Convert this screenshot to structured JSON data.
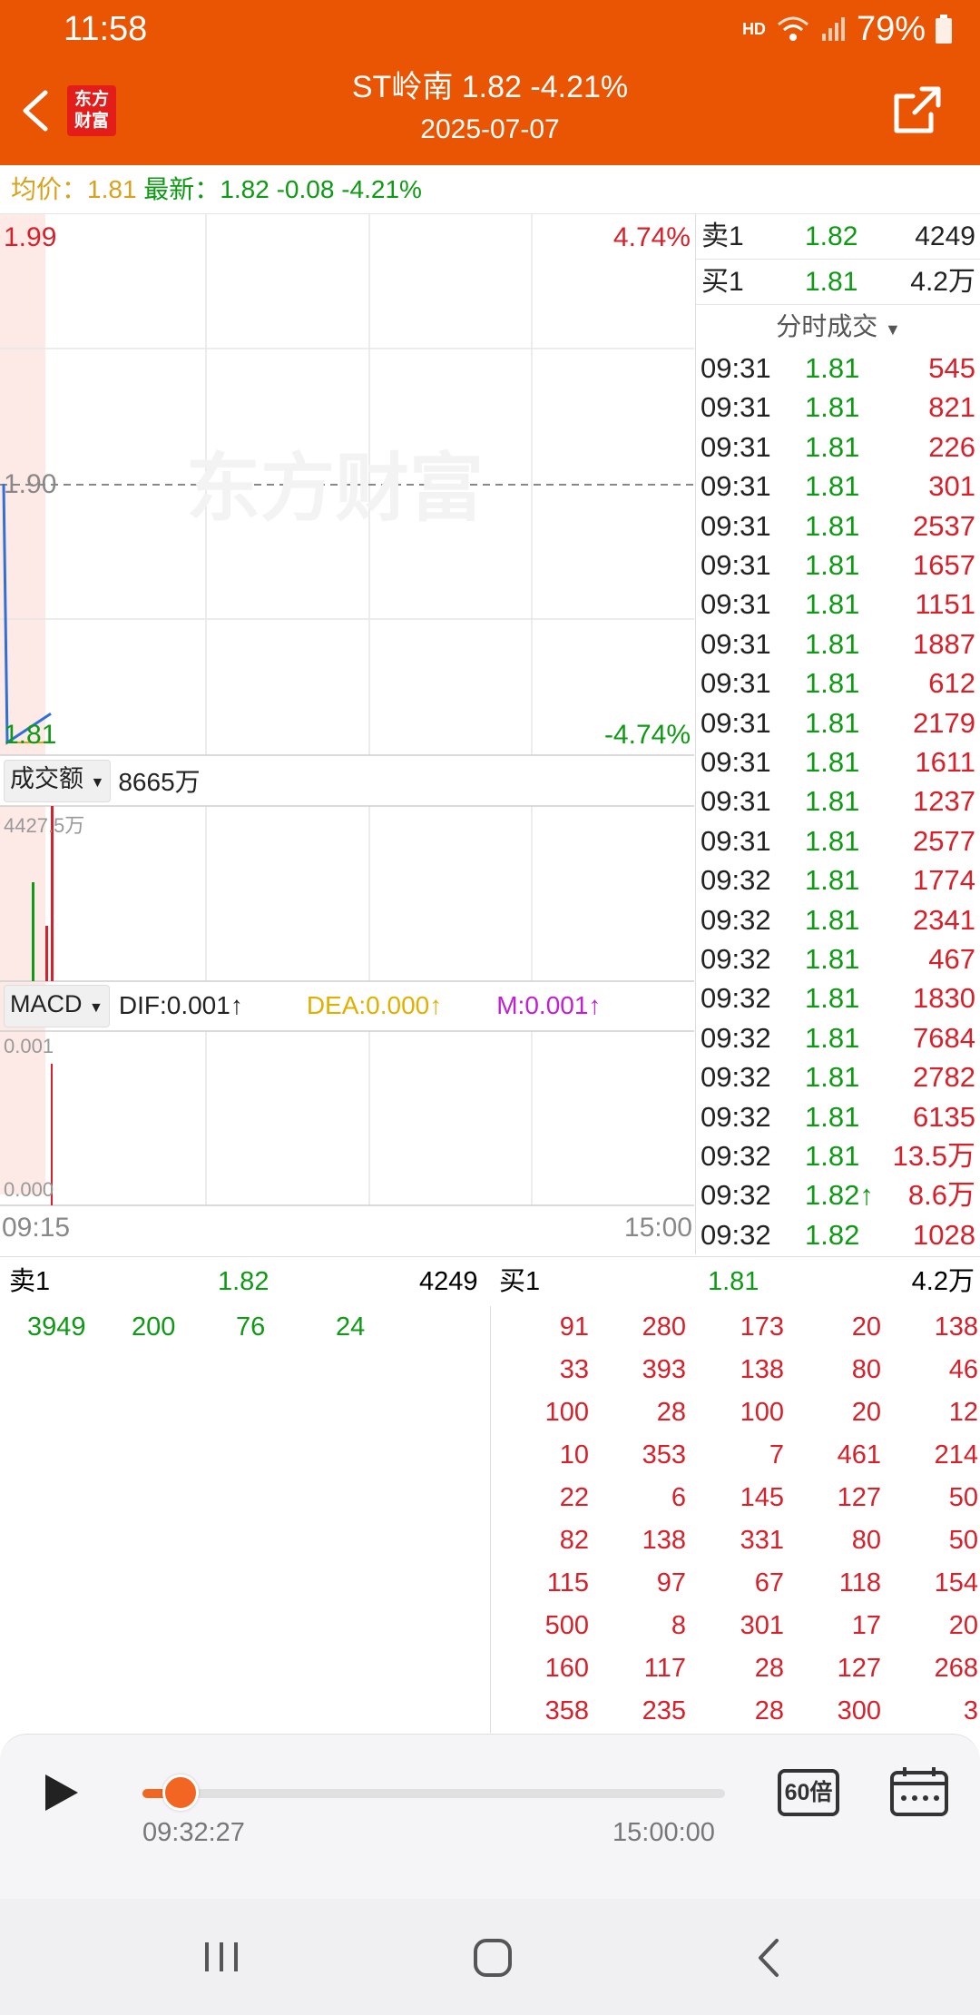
{
  "status_bar": {
    "time": "11:58",
    "network": "HD",
    "battery": "79%"
  },
  "header": {
    "title": "ST岭南  1.82  -4.21%",
    "date": "2025-07-07",
    "logo_text": "东方财富"
  },
  "summary": {
    "avg_label": "均价：",
    "avg_value": "1.81",
    "latest_label": "最新：",
    "latest_value": "1.82",
    "change": "-0.08",
    "change_pct": "-4.21%"
  },
  "chart": {
    "price_high": "1.99",
    "price_mid": "1.90",
    "price_low": "1.81",
    "pct_high": "4.74%",
    "pct_low": "-4.74%",
    "watermark": "东方财富",
    "volume_selector": "成交额",
    "volume_total": "8665万",
    "volume_max": "4427.5万",
    "macd_selector": "MACD",
    "dif": "DIF:0.001",
    "dea": "DEA:0.000",
    "m": "M:0.001",
    "macd_top": "0.001",
    "macd_bottom": "0.000",
    "time_start": "09:15",
    "time_end": "15:00"
  },
  "chart_data": {
    "type": "line",
    "series": [
      {
        "name": "price",
        "x": [
          "09:30",
          "09:31",
          "09:32"
        ],
        "values": [
          1.9,
          1.81,
          1.82
        ]
      }
    ],
    "ylim": [
      1.81,
      1.99
    ],
    "xlabel": "",
    "ylabel": ""
  },
  "quotes": {
    "sell1_label": "卖1",
    "sell1_price": "1.82",
    "sell1_vol": "4249",
    "buy1_label": "买1",
    "buy1_price": "1.81",
    "buy1_vol": "4.2万",
    "trades_title": "分时成交"
  },
  "trades": [
    {
      "time": "09:31",
      "price": "1.81",
      "vol": "545"
    },
    {
      "time": "09:31",
      "price": "1.81",
      "vol": "821"
    },
    {
      "time": "09:31",
      "price": "1.81",
      "vol": "226"
    },
    {
      "time": "09:31",
      "price": "1.81",
      "vol": "301"
    },
    {
      "time": "09:31",
      "price": "1.81",
      "vol": "2537"
    },
    {
      "time": "09:31",
      "price": "1.81",
      "vol": "1657"
    },
    {
      "time": "09:31",
      "price": "1.81",
      "vol": "1151"
    },
    {
      "time": "09:31",
      "price": "1.81",
      "vol": "1887"
    },
    {
      "time": "09:31",
      "price": "1.81",
      "vol": "612"
    },
    {
      "time": "09:31",
      "price": "1.81",
      "vol": "2179"
    },
    {
      "time": "09:31",
      "price": "1.81",
      "vol": "1611"
    },
    {
      "time": "09:31",
      "price": "1.81",
      "vol": "1237"
    },
    {
      "time": "09:31",
      "price": "1.81",
      "vol": "2577"
    },
    {
      "time": "09:32",
      "price": "1.81",
      "vol": "1774"
    },
    {
      "time": "09:32",
      "price": "1.81",
      "vol": "2341"
    },
    {
      "time": "09:32",
      "price": "1.81",
      "vol": "467"
    },
    {
      "time": "09:32",
      "price": "1.81",
      "vol": "1830"
    },
    {
      "time": "09:32",
      "price": "1.81",
      "vol": "7684"
    },
    {
      "time": "09:32",
      "price": "1.81",
      "vol": "2782"
    },
    {
      "time": "09:32",
      "price": "1.81",
      "vol": "6135"
    },
    {
      "time": "09:32",
      "price": "1.81",
      "vol": "13.5万"
    },
    {
      "time": "09:32",
      "price": "1.82↑",
      "vol": "8.6万"
    },
    {
      "time": "09:32",
      "price": "1.82",
      "vol": "1028"
    }
  ],
  "orderbook": {
    "sell_label": "卖1",
    "sell_price": "1.82",
    "sell_vol": "4249",
    "buy_label": "买1",
    "buy_price": "1.81",
    "buy_vol": "4.2万",
    "sell_queue": [
      "3949",
      "200",
      "76",
      "24"
    ],
    "buy_queue": [
      [
        "91",
        "280",
        "173",
        "20",
        "138"
      ],
      [
        "33",
        "393",
        "138",
        "80",
        "46"
      ],
      [
        "100",
        "28",
        "100",
        "20",
        "12"
      ],
      [
        "10",
        "353",
        "7",
        "461",
        "214"
      ],
      [
        "22",
        "6",
        "145",
        "127",
        "50"
      ],
      [
        "82",
        "138",
        "331",
        "80",
        "50"
      ],
      [
        "115",
        "97",
        "67",
        "118",
        "154"
      ],
      [
        "500",
        "8",
        "301",
        "17",
        "20"
      ],
      [
        "160",
        "117",
        "28",
        "127",
        "268"
      ],
      [
        "358",
        "235",
        "28",
        "300",
        "3"
      ]
    ]
  },
  "player": {
    "current_time": "09:32:27",
    "end_time": "15:00:00",
    "speed": "60倍",
    "progress": 0.05
  },
  "colors": {
    "brand": "#ea5504",
    "up": "#d8202a",
    "down": "#0e9a14",
    "avg": "#d9a21b"
  }
}
